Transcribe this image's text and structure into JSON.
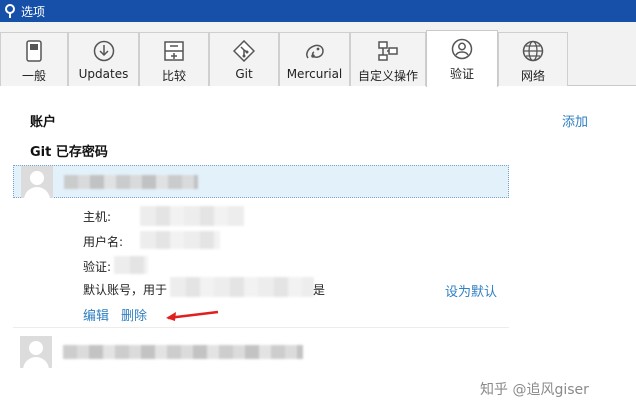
{
  "window": {
    "title": "选项"
  },
  "tabs": [
    {
      "label": "一般",
      "icon": "switch-icon"
    },
    {
      "label": "Updates",
      "icon": "download-icon"
    },
    {
      "label": "比较",
      "icon": "compare-icon"
    },
    {
      "label": "Git",
      "icon": "git-icon"
    },
    {
      "label": "Mercurial",
      "icon": "mercurial-icon"
    },
    {
      "label": "自定义操作",
      "icon": "custom-actions-icon"
    },
    {
      "label": "验证",
      "icon": "user-icon",
      "active": true
    },
    {
      "label": "网络",
      "icon": "globe-icon"
    }
  ],
  "accounts": {
    "heading": "账户",
    "add_label": "添加",
    "git_heading": "Git 已存密码",
    "details": {
      "host_label": "主机:",
      "user_label": "用户名:",
      "auth_label": "验证:",
      "default_prefix": "默认账号，用于",
      "default_suffix": "是",
      "set_default_label": "设为默认",
      "edit_label": "编辑",
      "delete_label": "删除"
    }
  },
  "watermark": "知乎 @追风giser",
  "colors": {
    "titlebar": "#1650a8",
    "link": "#2f7fc1",
    "selected_row": "#e3f1fb",
    "arrow": "#e02020"
  }
}
